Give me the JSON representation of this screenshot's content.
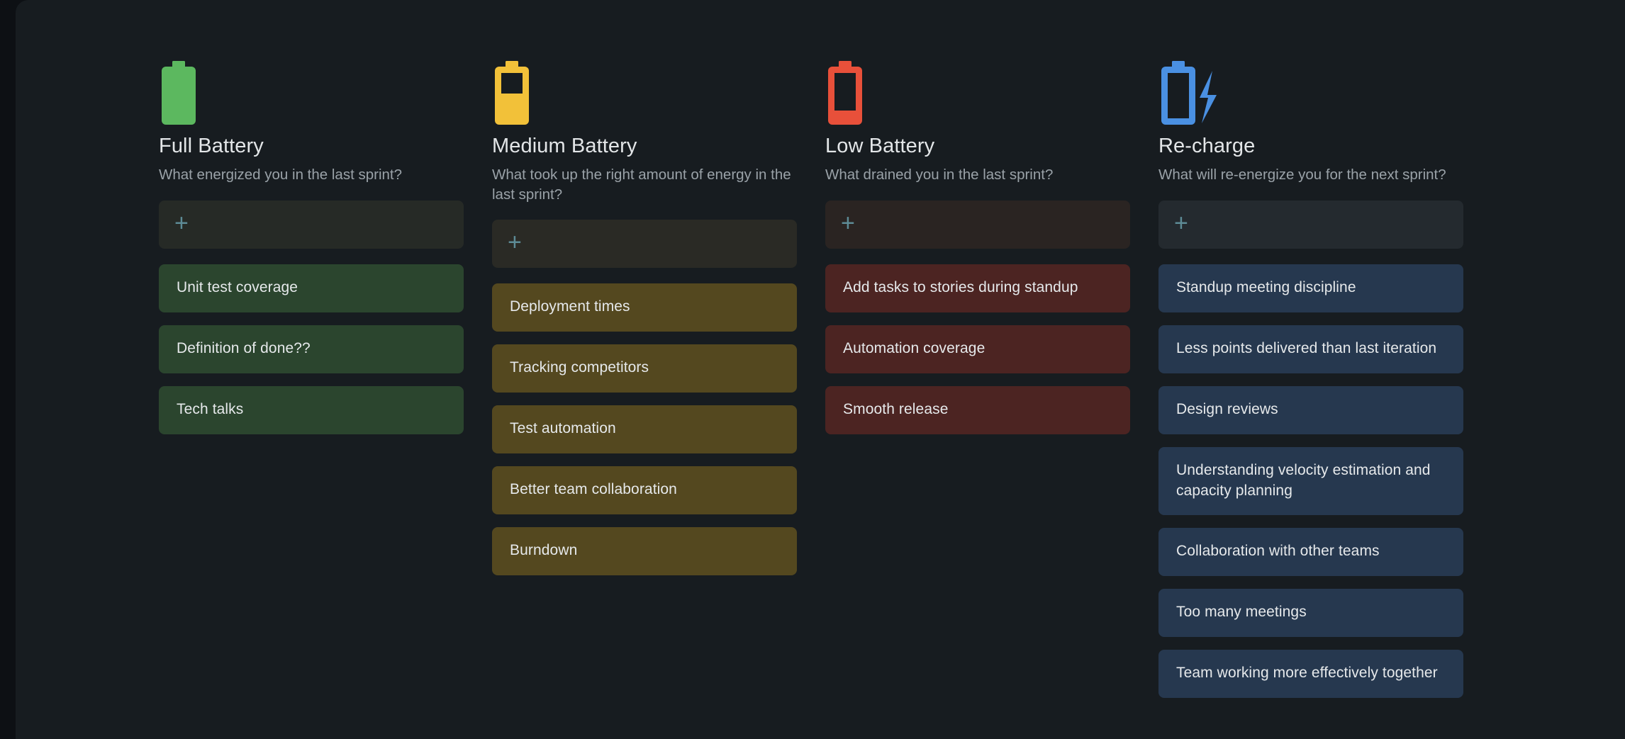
{
  "board": {
    "background_color": "#171c20",
    "page_background_color": "#0d1014"
  },
  "columns": [
    {
      "id": "full-battery",
      "icon": "battery-full-icon",
      "icon_color": "#5cb85f",
      "title": "Full Battery",
      "subtitle": "What energized you in the last sprint?",
      "add_label": "+",
      "add_card_color": "#262a26",
      "card_color": "#2b452e",
      "cards": [
        {
          "text": "Unit test coverage"
        },
        {
          "text": "Definition of done??"
        },
        {
          "text": "Tech talks"
        }
      ]
    },
    {
      "id": "medium-battery",
      "icon": "battery-medium-icon",
      "icon_color": "#f2c139",
      "title": "Medium Battery",
      "subtitle": "What took up the right amount of energy in the last sprint?",
      "add_label": "+",
      "add_card_color": "#2a2a25",
      "card_color": "#54481f",
      "cards": [
        {
          "text": "Deployment times"
        },
        {
          "text": "Tracking competitors"
        },
        {
          "text": "Test automation"
        },
        {
          "text": "Better team collaboration"
        },
        {
          "text": "Burndown"
        }
      ]
    },
    {
      "id": "low-battery",
      "icon": "battery-low-icon",
      "icon_color": "#e8503a",
      "title": "Low Battery",
      "subtitle": "What drained you in the last sprint?",
      "add_label": "+",
      "add_card_color": "#2a2422",
      "card_color": "#4c2422",
      "cards": [
        {
          "text": "Add tasks to stories during standup"
        },
        {
          "text": "Automation coverage"
        },
        {
          "text": "Smooth release"
        }
      ]
    },
    {
      "id": "re-charge",
      "icon": "battery-charging-icon",
      "icon_color": "#4a90e2",
      "title": "Re-charge",
      "subtitle": "What will re-energize you for the next sprint?",
      "add_label": "+",
      "add_card_color": "#242a2f",
      "card_color": "#26384f",
      "cards": [
        {
          "text": "Standup meeting discipline"
        },
        {
          "text": "Less points delivered than last iteration"
        },
        {
          "text": "Design reviews"
        },
        {
          "text": "Understanding velocity estimation and capacity planning"
        },
        {
          "text": "Collaboration with other teams"
        },
        {
          "text": "Too many meetings"
        },
        {
          "text": "Team working more effectively together"
        }
      ]
    }
  ]
}
